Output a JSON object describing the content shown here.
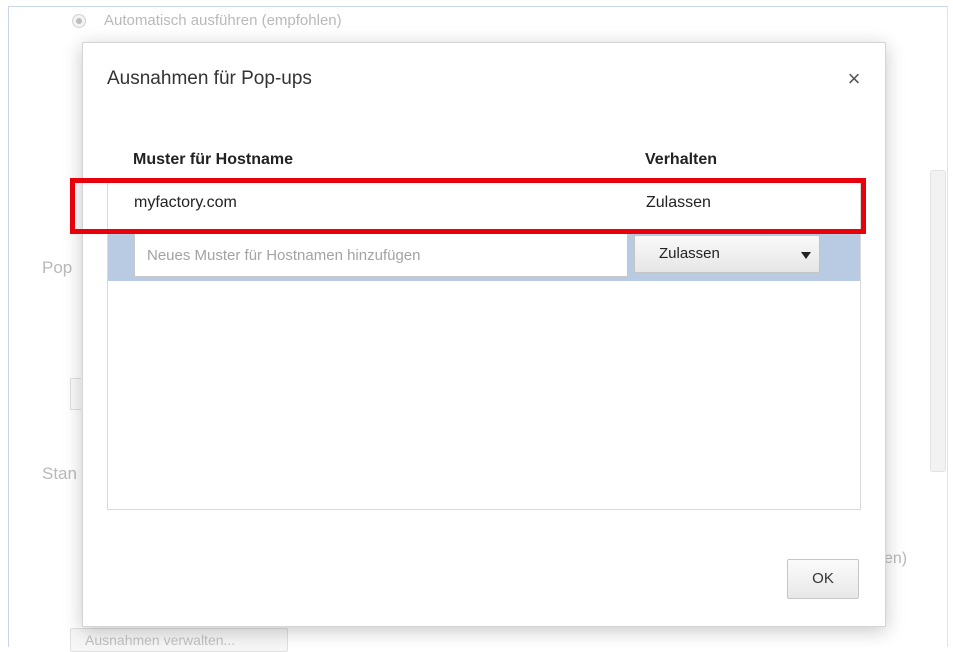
{
  "background": {
    "radio_autorun_label": "Automatisch ausführen (empfohlen)",
    "section_popup_label": "Pop",
    "section_standort_label": "Stan",
    "right_fragment": "en)",
    "manage_exceptions_button": "Ausnahmen verwalten..."
  },
  "dialog": {
    "title": "Ausnahmen für Pop-ups",
    "close_glyph": "×",
    "columns": {
      "hostname": "Muster für Hostname",
      "behavior": "Verhalten"
    },
    "rows": [
      {
        "hostname": "myfactory.com",
        "behavior": "Zulassen"
      }
    ],
    "new_entry": {
      "placeholder": "Neues Muster für Hostnamen hinzufügen",
      "value": "",
      "selected_behavior": "Zulassen"
    },
    "ok_label": "OK"
  },
  "colors": {
    "highlight": "#e8000b",
    "new_row_background": "#b9cae3"
  },
  "icons": {
    "close": "close-icon",
    "dropdown": "chevron-down-icon"
  }
}
